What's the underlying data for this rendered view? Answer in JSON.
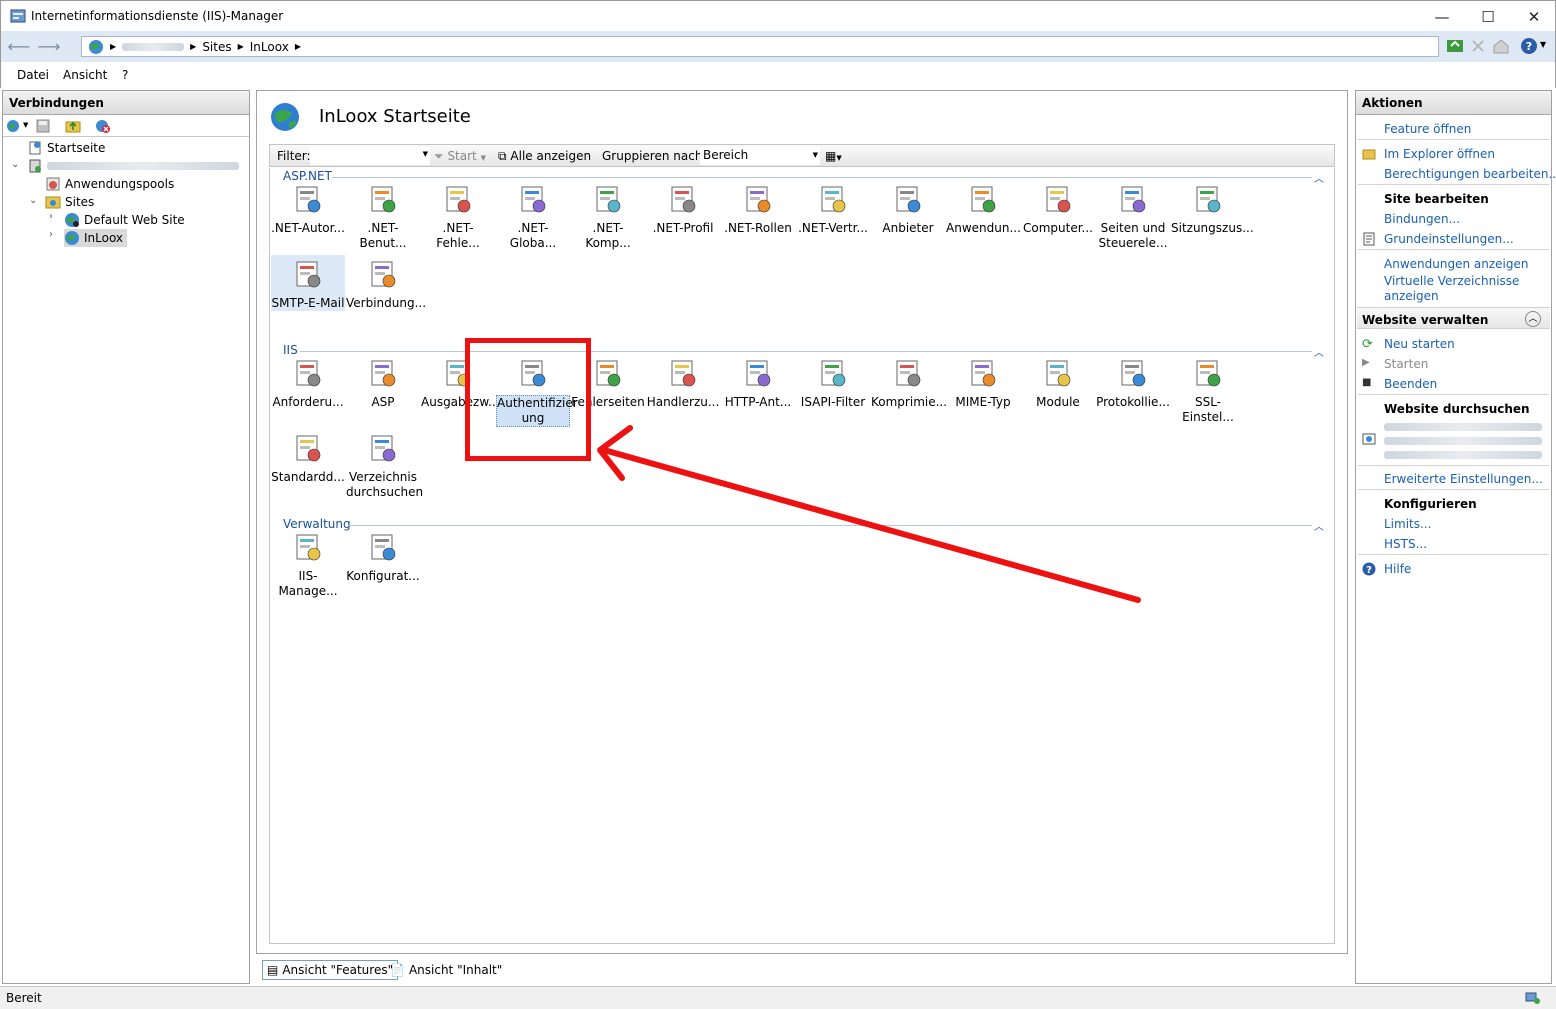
{
  "window": {
    "title": "Internetinformationsdienste (IIS)-Manager",
    "minimize": "—",
    "maximize": "☐",
    "close": "✕"
  },
  "address": {
    "crumbs": [
      "Sites",
      "InLoox"
    ]
  },
  "menu": {
    "file": "Datei",
    "view": "Ansicht",
    "help": "?"
  },
  "connections": {
    "header": "Verbindungen",
    "tree": {
      "start": "Startseite",
      "app_pools": "Anwendungspools",
      "sites": "Sites",
      "default_site": "Default Web Site",
      "inloox": "InLoox"
    }
  },
  "center": {
    "title": "InLoox Startseite",
    "filter": {
      "label": "Filter:",
      "start": "Start",
      "show_all": "Alle anzeigen",
      "group_by": "Gruppieren nach:",
      "group_value": "Bereich"
    },
    "groups": {
      "aspnet": {
        "label": "ASP.NET",
        "items": [
          ".NET-Autor...",
          ".NET-Benut...",
          ".NET-Fehle...",
          ".NET-Globa...",
          ".NET-Komp...",
          ".NET-Profil",
          ".NET-Rollen",
          ".NET-Vertr...",
          "Anbieter",
          "Anwendun...",
          "Computer...",
          "Seiten und Steuerele...",
          "Sitzungszus...",
          "SMTP-E-Mail",
          "Verbindung..."
        ]
      },
      "iis": {
        "label": "IIS",
        "items": [
          "Anforderu...",
          "ASP",
          "Ausgabezw...",
          "Authentifizier ung",
          "Fehlerseiten",
          "Handlerzu...",
          "HTTP-Ant...",
          "ISAPI-Filter",
          "Komprimie...",
          "MIME-Typ",
          "Module",
          "Protokollie...",
          "SSL-Einstel...",
          "Standardd...",
          "Verzeichnis durchsuchen"
        ]
      },
      "admin": {
        "label": "Verwaltung",
        "items": [
          "IIS-Manage...",
          "Konfigurat..."
        ]
      }
    },
    "tabs": {
      "features": "Ansicht \"Features\"",
      "content": "Ansicht \"Inhalt\""
    }
  },
  "actions": {
    "header": "Aktionen",
    "open_feature": "Feature öffnen",
    "explore": "Im Explorer öffnen",
    "edit_perms": "Berechtigungen bearbeiten...",
    "edit_site": "Site bearbeiten",
    "bindings": "Bindungen...",
    "basic_settings": "Grundeinstellungen...",
    "view_apps": "Anwendungen anzeigen",
    "view_vdirs": "Virtuelle Verzeichnisse anzeigen",
    "manage_site": "Website verwalten",
    "restart": "Neu starten",
    "start": "Starten",
    "stop": "Beenden",
    "browse_site": "Website durchsuchen",
    "advanced": "Erweiterte Einstellungen...",
    "configure": "Konfigurieren",
    "limits": "Limits...",
    "hsts": "HSTS...",
    "help": "Hilfe"
  },
  "status": {
    "text": "Bereit"
  },
  "colors": {
    "link": "#1a5fb4",
    "annotation": "#ee1111",
    "group": "#1a4e9a"
  }
}
